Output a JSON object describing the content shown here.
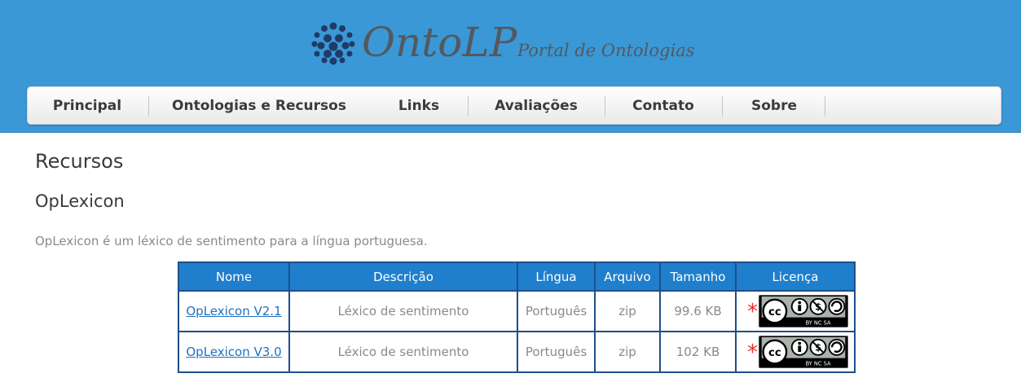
{
  "logo": {
    "name": "OntoLP",
    "tagline": "Portal de Ontologias"
  },
  "nav": {
    "items": [
      {
        "label": "Principal"
      },
      {
        "label": "Ontologias e Recursos"
      },
      {
        "label": "Links"
      },
      {
        "label": "Avaliações"
      },
      {
        "label": "Contato"
      },
      {
        "label": "Sobre"
      }
    ]
  },
  "page": {
    "title": "Recursos",
    "section_title": "OpLexicon",
    "intro": "OpLexicon é um léxico de sentimento para a língua portuguesa."
  },
  "table": {
    "headers": [
      "Nome",
      "Descrição",
      "Língua",
      "Arquivo",
      "Tamanho",
      "Licença"
    ],
    "rows": [
      {
        "nome": "OpLexicon V2.1",
        "descricao": "Léxico de sentimento",
        "lingua": "Português",
        "arquivo": "zip",
        "tamanho": "99.6 KB",
        "licenca_mark": "*",
        "licenca_badge": "BY NC SA"
      },
      {
        "nome": "OpLexicon V3.0",
        "descricao": "Léxico de sentimento",
        "lingua": "Português",
        "arquivo": "zip",
        "tamanho": "102 KB",
        "licenca_mark": "*",
        "licenca_badge": "BY NC SA"
      }
    ]
  },
  "colors": {
    "header_bg": "#3a98d6",
    "table_header": "#1f7fcc",
    "table_border": "#1e4f8a",
    "link": "#1f72c0",
    "star": "#e53030"
  },
  "icons": {
    "logo": "dot-cluster-icon",
    "license": "creative-commons-by-nc-sa-icon"
  }
}
